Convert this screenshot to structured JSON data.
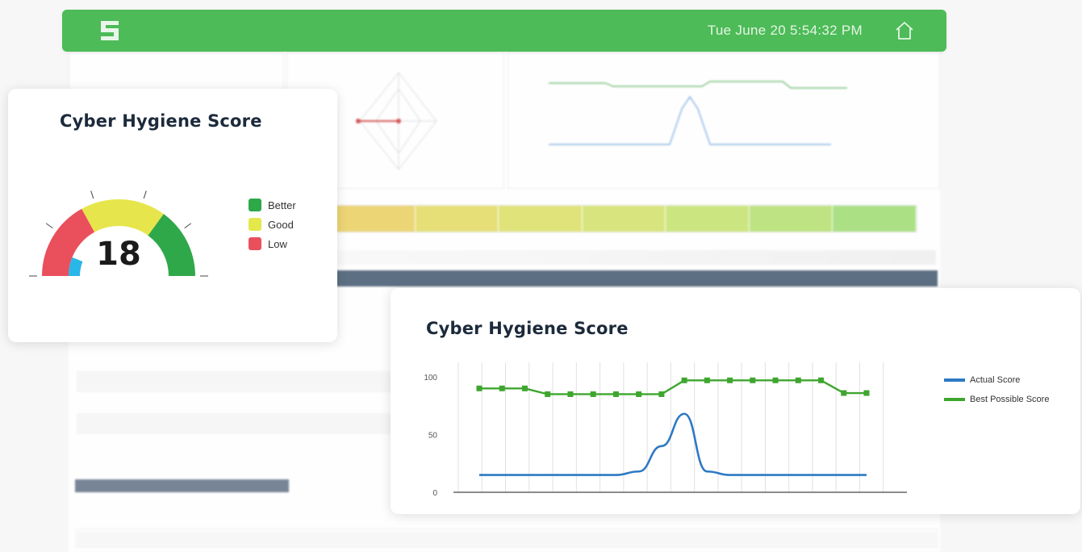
{
  "topbar": {
    "clock": "Tue June 20 5:54:32 PM"
  },
  "gauge": {
    "title": "Cyber Hygiene Score",
    "score": "18",
    "value": 18,
    "legend": [
      {
        "label": "Better",
        "color": "#2fa84a"
      },
      {
        "label": "Good",
        "color": "#e4e84a"
      },
      {
        "label": "Low",
        "color": "#ea4f5c"
      }
    ],
    "colors": {
      "low": "#ea4f5c",
      "good": "#e6e64c",
      "better": "#2fa84a",
      "needle": "#29b6e8"
    }
  },
  "line_card": {
    "title": "Cyber Hygiene Score",
    "y_tick_labels": [
      "100",
      "50",
      "0"
    ],
    "legend": [
      {
        "label": "Actual Score",
        "color": "#2e79c4"
      },
      {
        "label": "Best Possible Score",
        "color": "#3ea62e"
      }
    ]
  },
  "chart_data": {
    "type": "line",
    "title": "Cyber Hygiene Score",
    "ylim": [
      0,
      100
    ],
    "grid": true,
    "legend_position": "right",
    "series": [
      {
        "name": "Best Possible Score",
        "color": "#3ea62e",
        "markers": true,
        "values": [
          90,
          90,
          90,
          85,
          85,
          85,
          85,
          85,
          85,
          97,
          97,
          97,
          97,
          97,
          97,
          97,
          86,
          86
        ]
      },
      {
        "name": "Actual Score",
        "color": "#2e79c4",
        "markers": false,
        "values": [
          15,
          15,
          15,
          15,
          15,
          15,
          15,
          18,
          40,
          68,
          18,
          15,
          15,
          15,
          15,
          15,
          15,
          15
        ]
      }
    ]
  }
}
